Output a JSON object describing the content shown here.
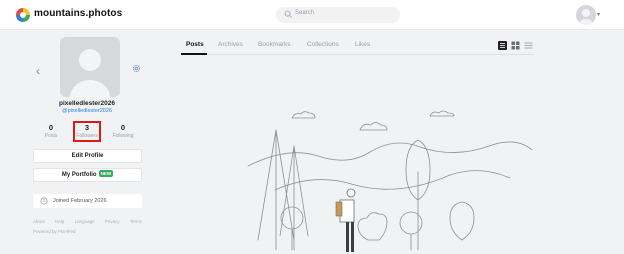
{
  "header": {
    "brand": "mountains.photos",
    "search_placeholder": "Search"
  },
  "profile": {
    "username": "pixelledlester2026",
    "handle": "@pixelledlester2026",
    "stats": [
      {
        "value": "0",
        "label": "Posts"
      },
      {
        "value": "3",
        "label": "Followers"
      },
      {
        "value": "0",
        "label": "Following"
      }
    ],
    "edit_profile_label": "Edit Profile",
    "portfolio_label": "My Portfolio",
    "portfolio_badge": "NEW",
    "joined": "Joined February 2026"
  },
  "footer": {
    "links": [
      "About",
      "Help",
      "Language",
      "Privacy",
      "Terms"
    ],
    "powered": "Powered by PixelFed"
  },
  "tabs": [
    {
      "label": "Posts",
      "active": true
    },
    {
      "label": "Archives",
      "active": false
    },
    {
      "label": "Bookmarks",
      "active": false
    },
    {
      "label": "Collections",
      "active": false
    },
    {
      "label": "Likes",
      "active": false
    }
  ],
  "colors": {
    "accent_blue": "#2f7de1",
    "badge_green": "#3aaa5c",
    "highlight_red": "#e01818"
  }
}
